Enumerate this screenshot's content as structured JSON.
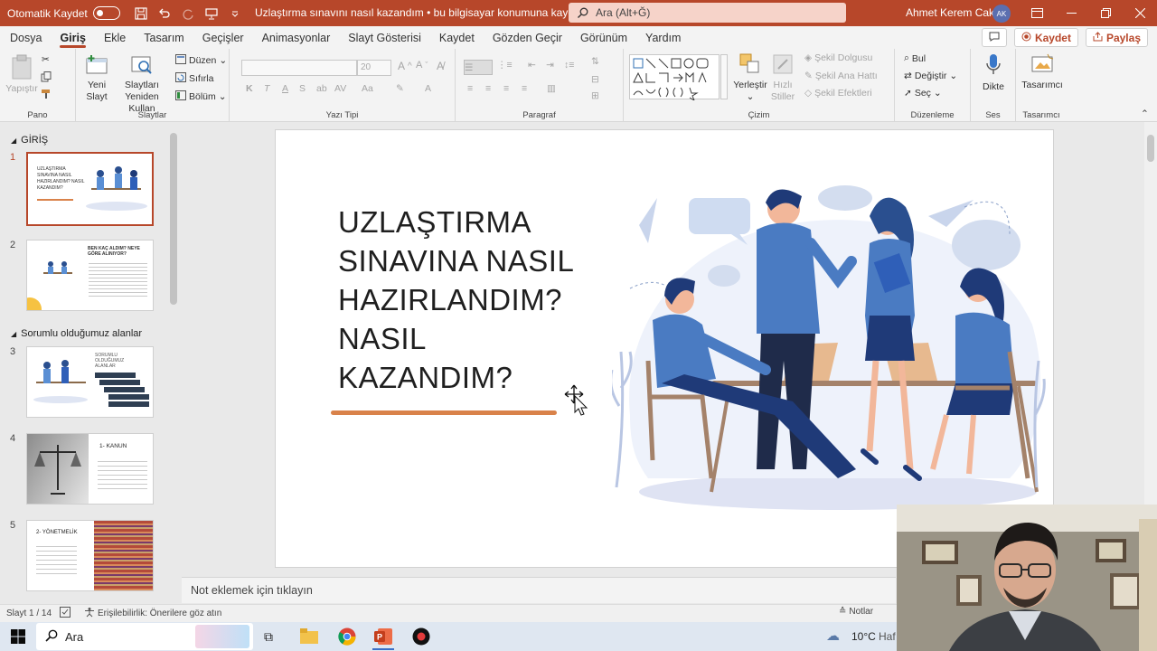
{
  "titlebar": {
    "autosave_label": "Otomatik Kaydet",
    "doc_title": "Uzlaştırma sınavını nasıl kazandım • bu bilgisayar konumuna kaydedildi ⌄",
    "search_placeholder": "Ara (Alt+Ğ)",
    "user_name": "Ahmet Kerem Cakin",
    "user_initials": "AK"
  },
  "menu": {
    "tabs": [
      "Dosya",
      "Giriş",
      "Ekle",
      "Tasarım",
      "Geçişler",
      "Animasyonlar",
      "Slayt Gösterisi",
      "Kaydet",
      "Gözden Geçir",
      "Görünüm",
      "Yardım"
    ],
    "active_tab": "Giriş",
    "record_button": "Kaydet",
    "share_button": "Paylaş"
  },
  "ribbon": {
    "pano": {
      "label": "Pano",
      "paste": "Yapıştır"
    },
    "slaytlar": {
      "label": "Slaytlar",
      "new_slide_1": "Yeni",
      "new_slide_2": "Slayt",
      "reuse_1": "Slaytları",
      "reuse_2": "Yeniden Kullan",
      "layout": "Düzen",
      "reset": "Sıfırla",
      "section": "Bölüm"
    },
    "yazi_tipi": {
      "label": "Yazı Tipi",
      "font_size": "20"
    },
    "paragraf": {
      "label": "Paragraf"
    },
    "cizim": {
      "label": "Çizim",
      "arrange_1": "Yerleştir",
      "quick_styles_1": "Hızlı",
      "quick_styles_2": "Stiller",
      "shape_fill": "Şekil Dolgusu",
      "shape_outline": "Şekil Ana Hattı",
      "shape_effects": "Şekil Efektleri"
    },
    "duzenleme": {
      "label": "Düzenleme",
      "find": "Bul",
      "replace": "Değiştir",
      "select": "Seç"
    },
    "ses": {
      "label": "Ses",
      "dictate": "Dikte"
    },
    "tasarimci": {
      "label": "Tasarımcı",
      "designer": "Tasarımcı"
    }
  },
  "sections": [
    {
      "title": "GİRİŞ"
    },
    {
      "title": "Sorumlu olduğumuz alanlar"
    }
  ],
  "thumbnails": [
    {
      "num": "1",
      "text": "UZLAŞTIRMA SINAVINA NASIL HAZIRLANDIM? NASIL KAZANDIM?"
    },
    {
      "num": "2",
      "text": "BEN KAÇ ALDIM? NEYE GÖRE ALINIYOR?"
    },
    {
      "num": "3",
      "text": "SORUMLU OLDUĞUMUZ ALANLAR"
    },
    {
      "num": "4",
      "text": "1- KANUN"
    },
    {
      "num": "5",
      "text": "2- YÖNETMELİK"
    }
  ],
  "slide": {
    "title_lines": [
      "UZLAŞTIRMA",
      "SINAVINA NASIL",
      "HAZIRLANDIM?",
      "NASIL",
      "KAZANDIM?"
    ]
  },
  "notes_placeholder": "Not eklemek için tıklayın",
  "status": {
    "slide_counter": "Slayt 1 / 14",
    "accessibility": "Erişilebilirlik: Önerilere göz atın",
    "notes_button": "Notlar"
  },
  "taskbar": {
    "search_label": "Ara",
    "temperature": "10°C",
    "weather_partial": "Haf"
  },
  "colors": {
    "accent": "#b7472a",
    "underline": "#d9824a",
    "figure_blue": "#4a7bc2",
    "figure_dark": "#1f3a78"
  }
}
